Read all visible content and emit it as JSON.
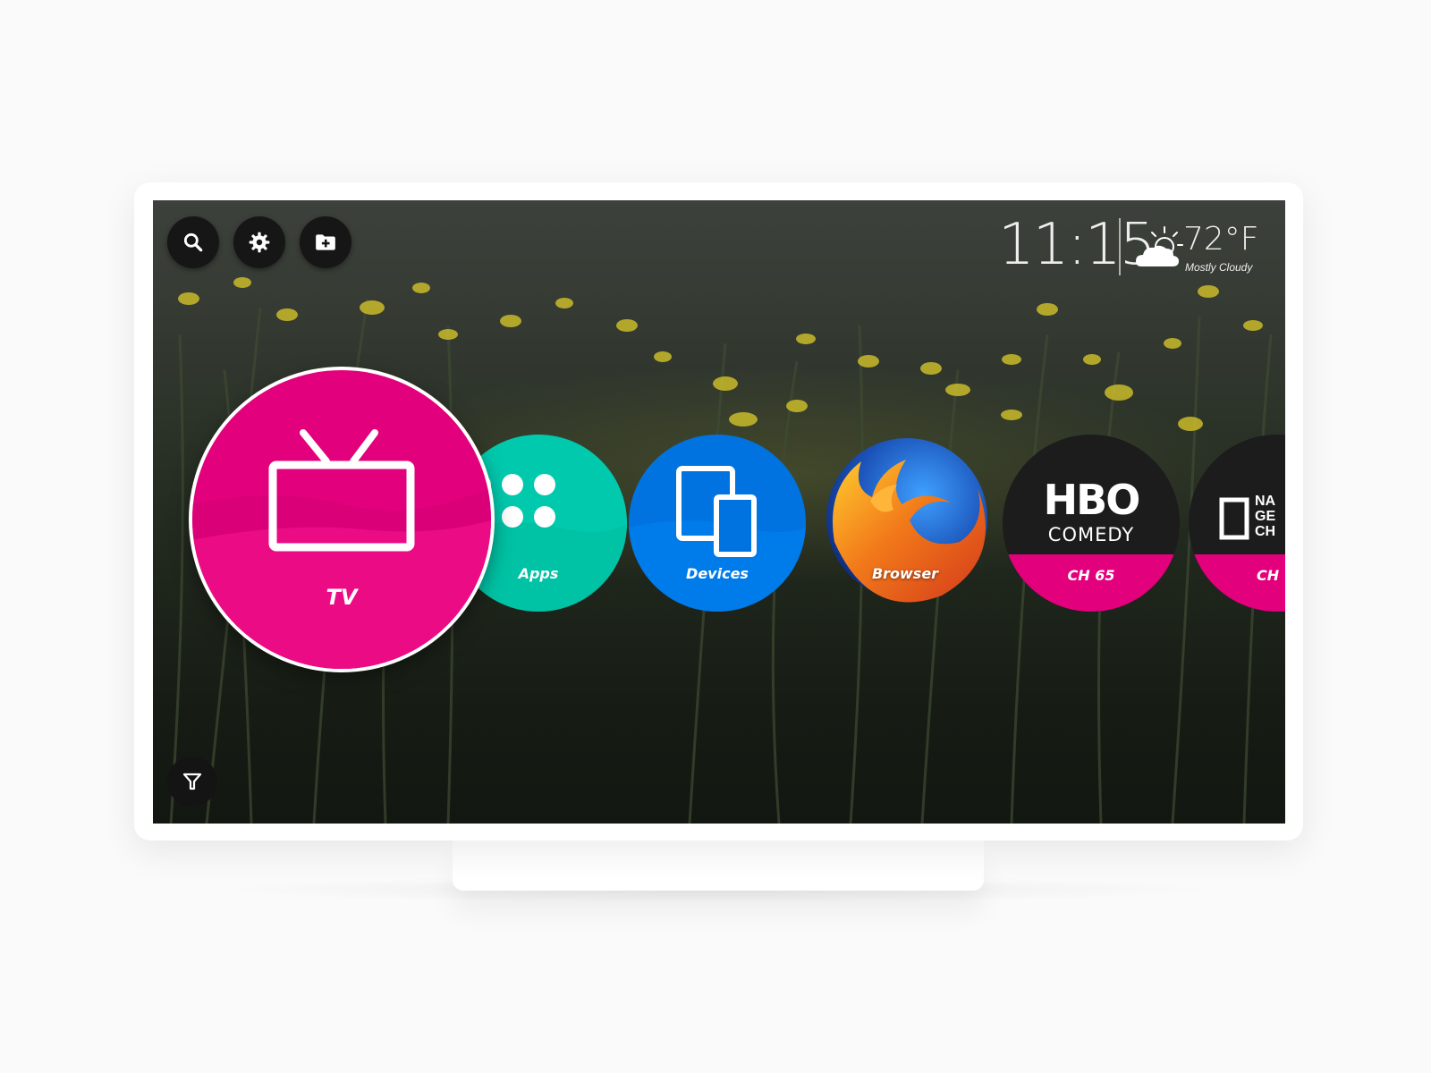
{
  "topbar": {
    "buttons": [
      {
        "icon": "search-icon"
      },
      {
        "icon": "gear-icon"
      },
      {
        "icon": "add-folder-icon"
      }
    ]
  },
  "status": {
    "time": "11:15",
    "temperature": "72°F",
    "weather": "Mostly Cloudy",
    "weather_icon": "sun-cloud-icon"
  },
  "tiles": [
    {
      "label": "TV",
      "color": "#e3007d",
      "icon": "tv-icon",
      "focused": true
    },
    {
      "label": "Apps",
      "color": "#00c9ad",
      "icon": "grid-dots-icon"
    },
    {
      "label": "Devices",
      "color": "#0073e0",
      "icon": "devices-icon"
    },
    {
      "label": "Browser",
      "icon": "firefox-logo-icon"
    },
    {
      "label": "CH 65",
      "logo_line1": "HBO",
      "logo_line2": "COMEDY",
      "color": "#e3007d"
    },
    {
      "label": "CH",
      "logo_line1": "NA",
      "logo_line2": "GE",
      "logo_line3": "CH",
      "color": "#e3007d"
    }
  ],
  "bottom": {
    "icon": "filter-icon"
  }
}
